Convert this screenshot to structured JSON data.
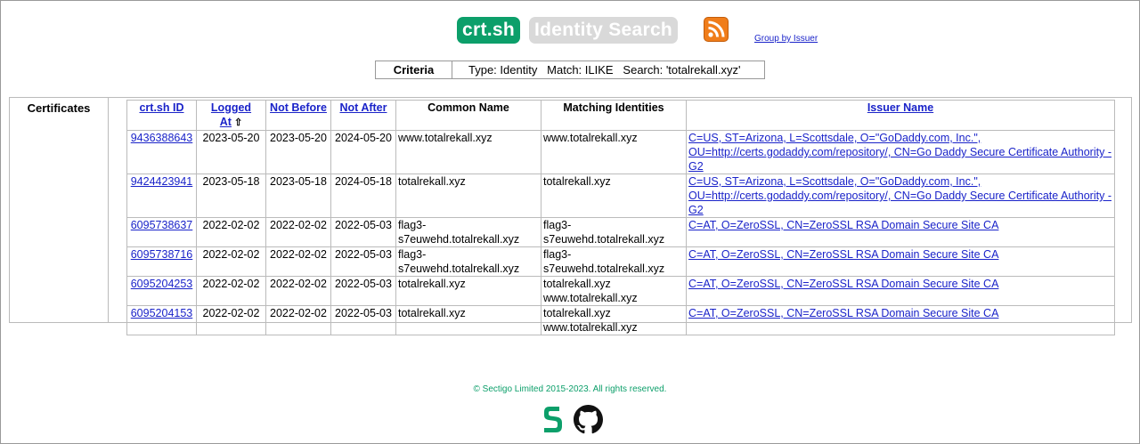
{
  "header": {
    "logo_main": "crt.sh",
    "logo_sub": "Identity Search",
    "rss_icon": "rss-feed-icon",
    "group_link": "Group by Issuer"
  },
  "criteria": {
    "label": "Criteria",
    "text": "Type: Identity   Match: ILIKE   Search: 'totalrekall.xyz'"
  },
  "results": {
    "section_label": "Certificates",
    "columns": [
      "crt.sh ID",
      "Logged At",
      "Not Before",
      "Not After",
      "Common Name",
      "Matching Identities",
      "Issuer Name"
    ],
    "sort_indicator": "⇧",
    "rows": [
      {
        "id": "9436388643",
        "logged": "2023-05-20",
        "not_before": "2023-05-20",
        "not_after": "2024-05-20",
        "common_name": "www.totalrekall.xyz",
        "identities": "www.totalrekall.xyz",
        "issuer": "C=US, ST=Arizona, L=Scottsdale, O=\"GoDaddy.com, Inc.\", OU=http://certs.godaddy.com/repository/, CN=Go Daddy Secure Certificate Authority - G2"
      },
      {
        "id": "9424423941",
        "logged": "2023-05-18",
        "not_before": "2023-05-18",
        "not_after": "2024-05-18",
        "common_name": "totalrekall.xyz",
        "identities": "totalrekall.xyz",
        "issuer": "C=US, ST=Arizona, L=Scottsdale, O=\"GoDaddy.com, Inc.\", OU=http://certs.godaddy.com/repository/, CN=Go Daddy Secure Certificate Authority - G2"
      },
      {
        "id": "6095738637",
        "logged": "2022-02-02",
        "not_before": "2022-02-02",
        "not_after": "2022-05-03",
        "common_name": "flag3-s7euwehd.totalrekall.xyz",
        "identities": "flag3-s7euwehd.totalrekall.xyz",
        "issuer": "C=AT, O=ZeroSSL, CN=ZeroSSL RSA Domain Secure Site CA"
      },
      {
        "id": "6095738716",
        "logged": "2022-02-02",
        "not_before": "2022-02-02",
        "not_after": "2022-05-03",
        "common_name": "flag3-s7euwehd.totalrekall.xyz",
        "identities": "flag3-s7euwehd.totalrekall.xyz",
        "issuer": "C=AT, O=ZeroSSL, CN=ZeroSSL RSA Domain Secure Site CA"
      },
      {
        "id": "6095204253",
        "logged": "2022-02-02",
        "not_before": "2022-02-02",
        "not_after": "2022-05-03",
        "common_name": "totalrekall.xyz",
        "identities": "totalrekall.xyz www.totalrekall.xyz",
        "issuer": "C=AT, O=ZeroSSL, CN=ZeroSSL RSA Domain Secure Site CA"
      },
      {
        "id": "6095204153",
        "logged": "2022-02-02",
        "not_before": "2022-02-02",
        "not_after": "2022-05-03",
        "common_name": "totalrekall.xyz",
        "identities": "totalrekall.xyz www.totalrekall.xyz",
        "issuer": "C=AT, O=ZeroSSL, CN=ZeroSSL RSA Domain Secure Site CA"
      }
    ]
  },
  "footer": {
    "copyright": "© Sectigo Limited 2015-2023. All rights reserved.",
    "icons": [
      "sectigo-logo-icon",
      "github-icon"
    ]
  },
  "colors": {
    "brand_green": "#0c9f6a",
    "logo_grey": "#d9d9d9",
    "link_blue": "#1a23c9",
    "rss_orange": "#f07d1a"
  }
}
